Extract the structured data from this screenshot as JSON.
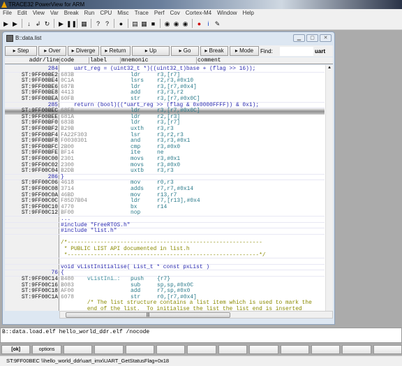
{
  "app": {
    "title": "TRACE32 PowerView for ARM"
  },
  "menu": [
    "File",
    "Edit",
    "View",
    "Var",
    "Break",
    "Run",
    "CPU",
    "Misc",
    "Trace",
    "Perf",
    "Cov",
    "Cortex-M4",
    "Window",
    "Help"
  ],
  "toolbar_icons": [
    "single-step-icon",
    "step-over-icon",
    "step-down-icon",
    "return-icon",
    "up-icon",
    "go-icon",
    "break-icon",
    "mode-icon",
    "help-icon",
    "context-help-icon",
    "stop-icon",
    "list-icon",
    "register-icon",
    "memory-icon",
    "watch-icon",
    "var-icon",
    "var-watch-icon",
    "trace-icon",
    "info-icon",
    "tools-icon"
  ],
  "window": {
    "title": "B::data.list",
    "buttons": [
      {
        "label": "Step",
        "icon": "step-icon"
      },
      {
        "label": "Over",
        "icon": "over-icon"
      },
      {
        "label": "Diverge",
        "icon": "diverge-icon"
      },
      {
        "label": "Return",
        "icon": "return-icon"
      },
      {
        "label": "Up",
        "icon": "up-icon"
      },
      {
        "label": "Go",
        "icon": "go-icon"
      },
      {
        "label": "Break",
        "icon": "break-icon"
      },
      {
        "label": "Mode",
        "icon": "mode-icon"
      }
    ],
    "find_label": "Find:",
    "find_value": "",
    "find_extra": "uart",
    "columns": [
      "addr/line",
      "code",
      "label",
      "mnemonic",
      "comment"
    ],
    "rows": [
      {
        "t": "src",
        "a": "284",
        "s": "    uart_reg = (uint32_t *)((uint32_t)base + (flag >> 16));"
      },
      {
        "t": "asm",
        "a": "ST:9FF00BE2",
        "c": "683B",
        "m": "ldr",
        "o": "r3,[r7]"
      },
      {
        "t": "asm",
        "a": "ST:9FF00BE4",
        "c": "0C1A",
        "m": "lsrs",
        "o": "r2,r3,#0x10"
      },
      {
        "t": "asm",
        "a": "ST:9FF00BE6",
        "c": "687B",
        "m": "ldr",
        "o": "r3,[r7,#0x4]"
      },
      {
        "t": "asm",
        "a": "ST:9FF00BE8",
        "c": "4413",
        "m": "add",
        "o": "r3,r3,r2"
      },
      {
        "t": "asm",
        "a": "ST:9FF00BEA",
        "c": "60FB",
        "m": "str",
        "o": "r3,[r7,#0x0C]"
      },
      {
        "t": "src",
        "a": "285",
        "s": "    return (bool)((*uart_reg >> (flag & 0x0000FFFF)) & 0x1);"
      },
      {
        "t": "sel",
        "a": "ST:9FF00BEC",
        "c": "68FB",
        "m": "ldr",
        "o": "r3,[r7,#0x0C]"
      },
      {
        "t": "asm",
        "a": "ST:9FF00BEE",
        "c": "681A",
        "m": "ldr",
        "o": "r2,[r3]"
      },
      {
        "t": "asm",
        "a": "ST:9FF00BF0",
        "c": "683B",
        "m": "ldr",
        "o": "r3,[r7]"
      },
      {
        "t": "asm",
        "a": "ST:9FF00BF2",
        "c": "B29B",
        "m": "uxth",
        "o": "r3,r3"
      },
      {
        "t": "asm",
        "a": "ST:9FF00BF4",
        "c": "FA22F303",
        "m": "lsr",
        "o": "r3,r2,r3"
      },
      {
        "t": "asm",
        "a": "ST:9FF00BF8",
        "c": "F0030301",
        "m": "and",
        "o": "r3,r3,#0x1"
      },
      {
        "t": "asm",
        "a": "ST:9FF00BFC",
        "c": "2B00",
        "m": "cmp",
        "o": "r3,#0x0"
      },
      {
        "t": "asm",
        "a": "ST:9FF00BFE",
        "c": "BF14",
        "m": "ite",
        "o": "ne"
      },
      {
        "t": "asm",
        "a": "ST:9FF00C00",
        "c": "2301",
        "m": "movs",
        "o": "r3,#0x1"
      },
      {
        "t": "asm",
        "a": "ST:9FF00C02",
        "c": "2300",
        "m": "movs",
        "o": "r3,#0x0"
      },
      {
        "t": "asm",
        "a": "ST:9FF00C04",
        "c": "B2DB",
        "m": "uxtb",
        "o": "r3,r3"
      },
      {
        "t": "src",
        "a": "286",
        "s": "}"
      },
      {
        "t": "asm",
        "a": "ST:9FF00C06",
        "c": "4618",
        "m": "mov",
        "o": "r0,r3"
      },
      {
        "t": "asm",
        "a": "ST:9FF00C08",
        "c": "3714",
        "m": "adds",
        "o": "r7,r7,#0x14"
      },
      {
        "t": "asm",
        "a": "ST:9FF00C0A",
        "c": "46BD",
        "m": "mov",
        "o": "r13,r7"
      },
      {
        "t": "asm",
        "a": "ST:9FF00C0C",
        "c": "F85D7B04",
        "m": "ldr",
        "o": "r7,[r13],#0x4"
      },
      {
        "t": "asm",
        "a": "ST:9FF00C10",
        "c": "4770",
        "m": "bx",
        "o": "r14"
      },
      {
        "t": "asm",
        "a": "ST:9FF00C12",
        "c": "BF00",
        "m": "nop",
        "o": ""
      },
      {
        "t": "src",
        "a": "",
        "s": "..."
      },
      {
        "t": "src",
        "a": "",
        "s": "#include \"FreeRTOS.h\""
      },
      {
        "t": "src",
        "a": "",
        "s": "#include \"list.h\""
      },
      {
        "t": "src",
        "a": "",
        "s": ""
      },
      {
        "t": "cmt",
        "a": "",
        "s": "/*-----------------------------------------------------------"
      },
      {
        "t": "cmt",
        "a": "",
        "s": " * PUBLIC LIST API documented in list.h"
      },
      {
        "t": "cmt",
        "a": "",
        "s": " *----------------------------------------------------------*/"
      },
      {
        "t": "src",
        "a": "",
        "s": ""
      },
      {
        "t": "src",
        "a": "",
        "s": "void vListInitialise( List_t * const pxList )"
      },
      {
        "t": "src",
        "a": "76",
        "s": "{"
      },
      {
        "t": "asm",
        "a": "ST:9FF00C14",
        "c": "B480",
        "l": "vListIni…:",
        "m": "push",
        "o": "{r7}"
      },
      {
        "t": "asm",
        "a": "ST:9FF00C16",
        "c": "B083",
        "m": "sub",
        "o": "sp,sp,#0x0C"
      },
      {
        "t": "asm",
        "a": "ST:9FF00C18",
        "c": "AF00",
        "m": "add",
        "o": "r7,sp,#0x0"
      },
      {
        "t": "asm",
        "a": "ST:9FF00C1A",
        "c": "6078",
        "m": "str",
        "o": "r0,[r7,#0x4]"
      },
      {
        "t": "cmt",
        "a": "",
        "s": "        /* The list structure contains a list item which is used to mark the"
      },
      {
        "t": "cmt",
        "a": "",
        "s": "        end of the list.  To initialise the list the list end is inserted"
      }
    ]
  },
  "command": {
    "value": "B::data.load.elf hello_world_ddr.elf /nocode"
  },
  "footer_buttons": [
    "[ok]",
    "options",
    "",
    "",
    "",
    "",
    "",
    "",
    "",
    "",
    "",
    "",
    ""
  ],
  "status": {
    "text": "ST:9FF00BEC  \\\\hello_world_ddr\\uart_imx\\UART_GetStatusFlag+0x18"
  }
}
